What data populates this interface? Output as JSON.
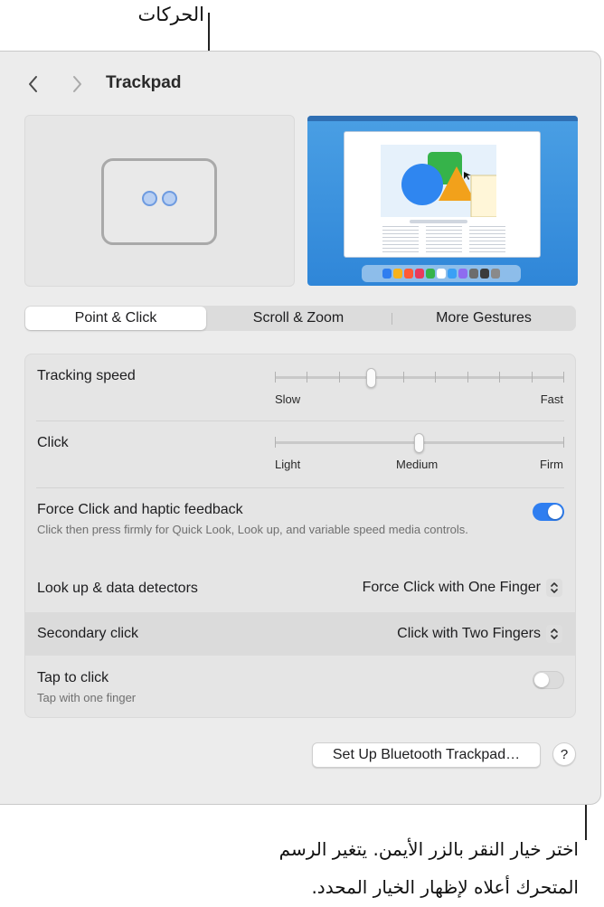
{
  "callouts": {
    "top": "الحركات",
    "bottom_line1": "اختر خيار النقر بالزر الأيمن. يتغير الرسم",
    "bottom_line2": "المتحرك أعلاه لإظهار الخيار المحدد."
  },
  "window": {
    "title": "Trackpad",
    "back_icon": "chevron-left-icon",
    "forward_icon": "chevron-right-icon"
  },
  "tabs": [
    {
      "label": "Point & Click",
      "selected": true
    },
    {
      "label": "Scroll & Zoom",
      "selected": false
    },
    {
      "label": "More Gestures",
      "selected": false
    }
  ],
  "settings": {
    "tracking_speed": {
      "label": "Tracking speed",
      "min_label": "Slow",
      "max_label": "Fast",
      "value_fraction": 0.33
    },
    "click": {
      "label": "Click",
      "labels": [
        "Light",
        "Medium",
        "Firm"
      ],
      "value": "Medium"
    },
    "force_click": {
      "label": "Force Click and haptic feedback",
      "description": "Click then press firmly for Quick Look, Look up, and variable speed media controls.",
      "enabled": true
    },
    "look_up": {
      "label": "Look up & data detectors",
      "value": "Force Click with One Finger"
    },
    "secondary_click": {
      "label": "Secondary click",
      "value": "Click with Two Fingers"
    },
    "tap_to_click": {
      "label": "Tap to click",
      "description": "Tap with one finger",
      "enabled": false
    }
  },
  "buttons": {
    "bluetooth": "Set Up Bluetooth Trackpad…",
    "help": "?"
  },
  "colors": {
    "accent": "#2f7ef0",
    "toggle_off": "#dcdcdc",
    "panel": "#e5e5e5",
    "window": "#ececec"
  }
}
